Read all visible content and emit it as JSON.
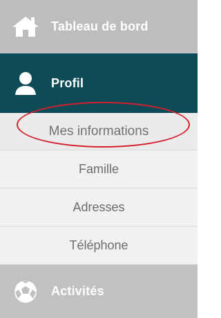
{
  "menu": {
    "dashboard": {
      "label": "Tableau de bord",
      "icon": "home-icon"
    },
    "profile": {
      "label": "Profil",
      "icon": "user-icon",
      "submenu": [
        {
          "label": "Mes informations",
          "selected": true
        },
        {
          "label": "Famille",
          "selected": false
        },
        {
          "label": "Adresses",
          "selected": false
        },
        {
          "label": "Téléphone",
          "selected": false
        }
      ]
    },
    "activities": {
      "label": "Activités",
      "icon": "soccer-ball-icon"
    }
  },
  "colors": {
    "active_background": "#0d4b56",
    "inactive_background": "#bdbdbd",
    "submenu_background": "#f1f1f1",
    "highlight_outline": "#d51f2e"
  }
}
